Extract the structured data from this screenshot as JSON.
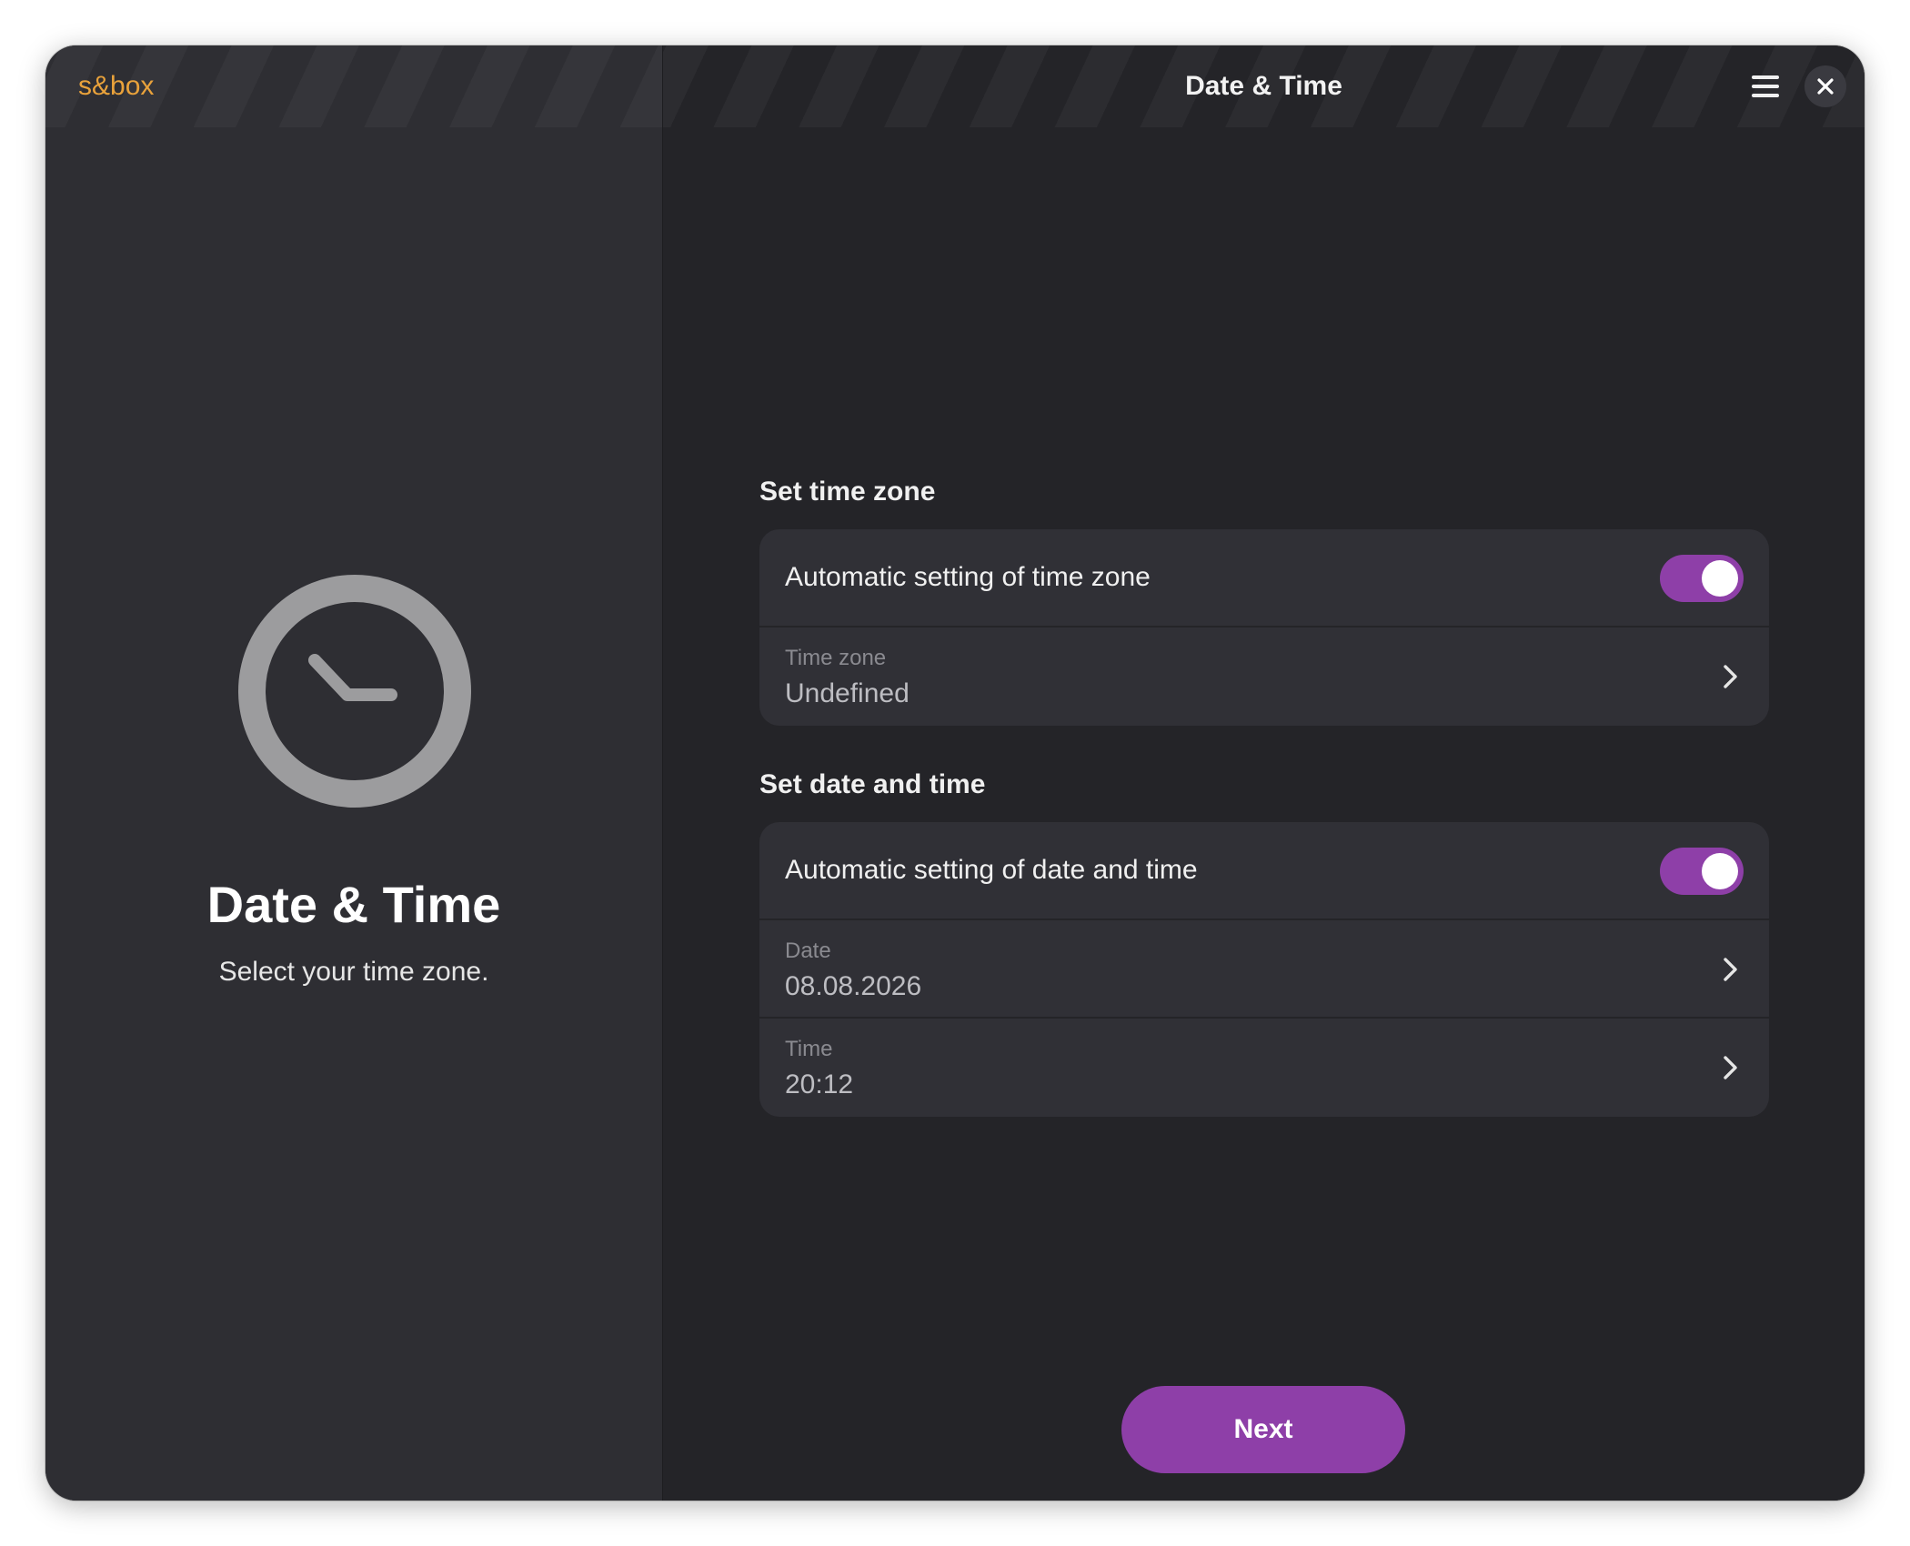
{
  "app": {
    "brand": "s&box",
    "window_title": "Date & Time"
  },
  "sidebar": {
    "icon": "clock-icon",
    "title": "Date & Time",
    "subtitle": "Select your time zone."
  },
  "timezone_section": {
    "heading": "Set time zone",
    "auto_label": "Automatic setting of time zone",
    "auto_enabled": true,
    "field_label": "Time zone",
    "field_value": "Undefined"
  },
  "datetime_section": {
    "heading": "Set date and time",
    "auto_label": "Automatic setting of date and time",
    "auto_enabled": true,
    "date_label": "Date",
    "date_value": "08.08.2026",
    "time_label": "Time",
    "time_value": "20:12"
  },
  "actions": {
    "next_label": "Next"
  },
  "colors": {
    "accent": "#8e3fa8",
    "brand": "#e9a23b",
    "background": "#242428",
    "sidebar": "#2e2e33",
    "card": "#303036"
  }
}
